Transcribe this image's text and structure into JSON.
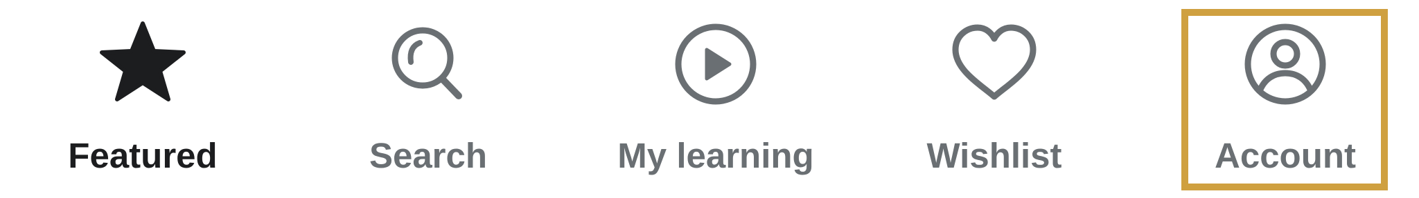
{
  "tabs": [
    {
      "id": "featured",
      "label": "Featured",
      "icon": "star-icon",
      "state": "active"
    },
    {
      "id": "search",
      "label": "Search",
      "icon": "search-icon",
      "state": "inactive"
    },
    {
      "id": "my_learning",
      "label": "My learning",
      "icon": "play-circle-icon",
      "state": "inactive"
    },
    {
      "id": "wishlist",
      "label": "Wishlist",
      "icon": "heart-icon",
      "state": "inactive"
    },
    {
      "id": "account",
      "label": "Account",
      "icon": "account-circle-icon",
      "state": "inactive",
      "focused": true
    }
  ],
  "colors": {
    "active": "#1c1d1f",
    "inactive": "#6a6f73",
    "focus_ring": "#cfa040",
    "background": "#ffffff"
  }
}
